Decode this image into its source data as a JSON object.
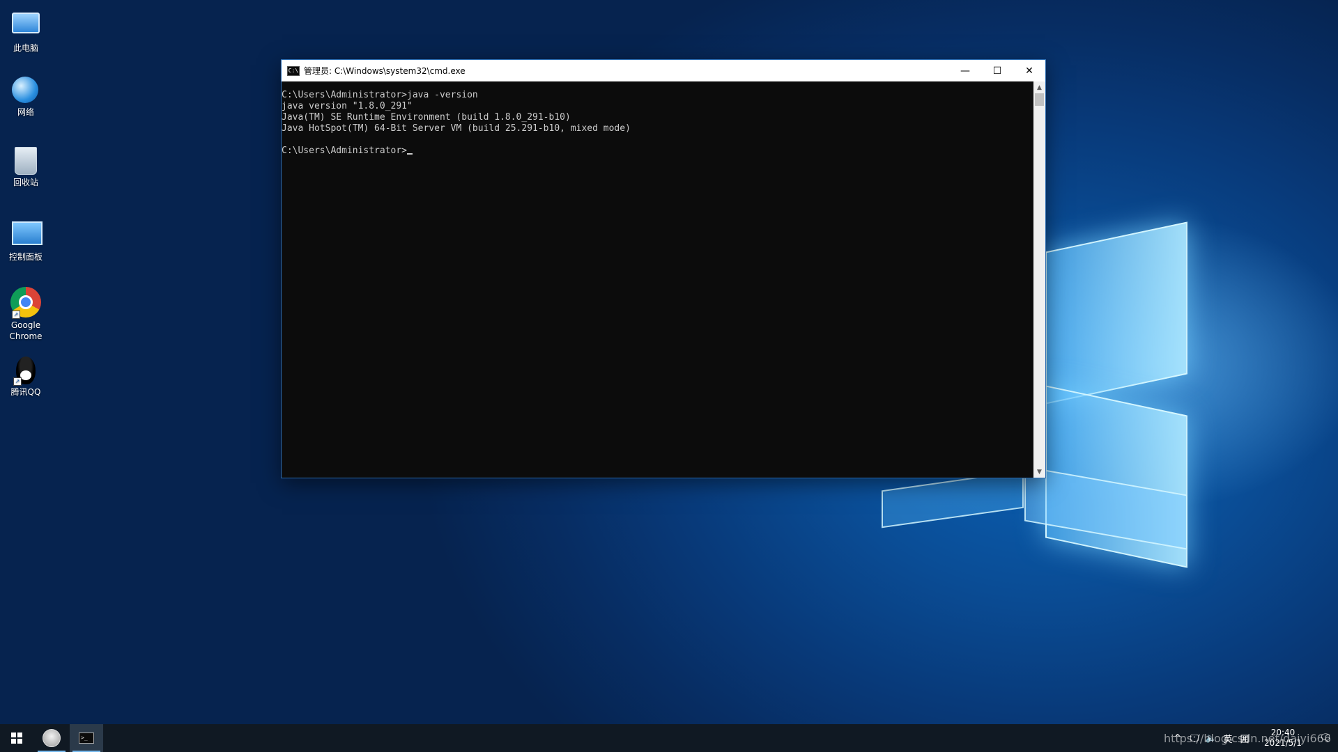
{
  "desktop": {
    "icons": [
      {
        "label": "此电脑"
      },
      {
        "label": "网络"
      },
      {
        "label": "回收站"
      },
      {
        "label": "控制面板"
      },
      {
        "label": "Google Chrome"
      },
      {
        "label": "腾讯QQ"
      }
    ]
  },
  "cmd_window": {
    "title": "管理员: C:\\Windows\\system32\\cmd.exe",
    "icon_text": "C:\\",
    "buttons": {
      "minimize": "—",
      "maximize": "☐",
      "close": "✕"
    },
    "lines": [
      "C:\\Users\\Administrator>java -version",
      "java version \"1.8.0_291\"",
      "Java(TM) SE Runtime Environment (build 1.8.0_291-b10)",
      "Java HotSpot(TM) 64-Bit Server VM (build 25.291-b10, mixed mode)",
      "",
      "C:\\Users\\Administrator>"
    ],
    "scroll": {
      "up": "▲",
      "down": "▼"
    }
  },
  "taskbar": {
    "cmd_icon_text": ">_",
    "tray": {
      "chevron": "^",
      "network": "🖵",
      "volume": "🔈",
      "ime": "英",
      "ime2": "囲",
      "notification": "🗨"
    },
    "clock": {
      "time": "20:40",
      "date": "2021/5/1"
    }
  },
  "watermark": "https://blog.csdn.net/daiyi666"
}
